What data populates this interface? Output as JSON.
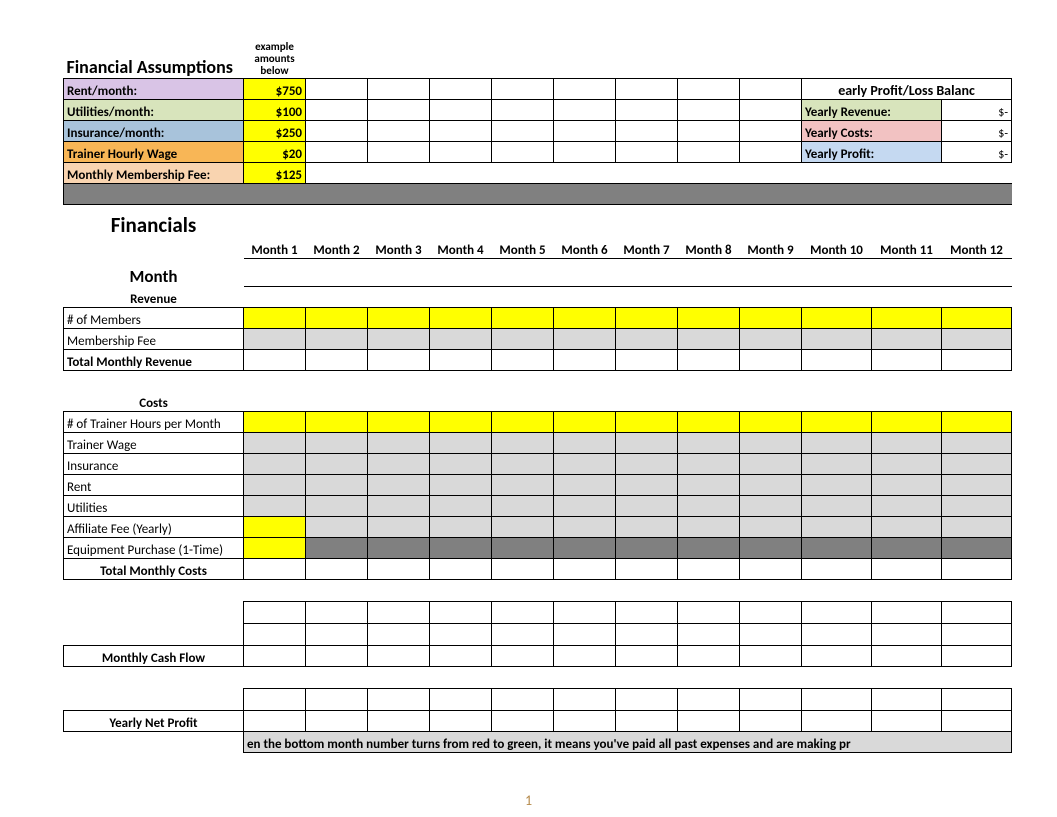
{
  "header_title": "Financial Assumptions",
  "example_note": "example amounts below",
  "assumptions": {
    "rent": {
      "label": "Rent/month:",
      "value": "$750"
    },
    "util": {
      "label": "Utilities/month:",
      "value": "$100"
    },
    "ins": {
      "label": "Insurance/month:",
      "value": "$250"
    },
    "wage": {
      "label": "Trainer Hourly Wage",
      "value": "$20"
    },
    "memfee": {
      "label": "Monthly Membership Fee:",
      "value": "$125"
    }
  },
  "plbox": {
    "title": "early Profit/Loss Balanc",
    "rows": [
      {
        "label": "Yearly Revenue:",
        "value": "$-",
        "cls": "pl-green"
      },
      {
        "label": "Yearly Costs:",
        "value": "$-",
        "cls": "pl-red"
      },
      {
        "label": "Yearly Profit:",
        "value": "$-",
        "cls": "pl-blue"
      }
    ]
  },
  "fin_title": "Financials",
  "fin_sub": "Month",
  "months": [
    "Month 1",
    "Month 2",
    "Month 3",
    "Month 4",
    "Month 5",
    "Month 6",
    "Month 7",
    "Month 8",
    "Month 9",
    "Month 10",
    "Month 11",
    "Month 12"
  ],
  "sections": {
    "revenue": "Revenue",
    "costs": "Costs"
  },
  "rows": {
    "members": "# of Members",
    "memfee": "Membership Fee",
    "totrev": "Total Monthly Revenue",
    "thours": "# of Trainer Hours per Month",
    "twage": "Trainer Wage",
    "ins": "Insurance",
    "rent": "Rent",
    "util": "Utilities",
    "aff": "Affiliate Fee (Yearly)",
    "equip": "Equipment Purchase (1-Time)",
    "totcost": "Total Monthly Costs",
    "cashflow": "Monthly Cash Flow",
    "netprofit": "Yearly Net Profit"
  },
  "footnote": "en the bottom month number turns from red to green, it means you've paid all past expenses and are making pr",
  "page": "1"
}
